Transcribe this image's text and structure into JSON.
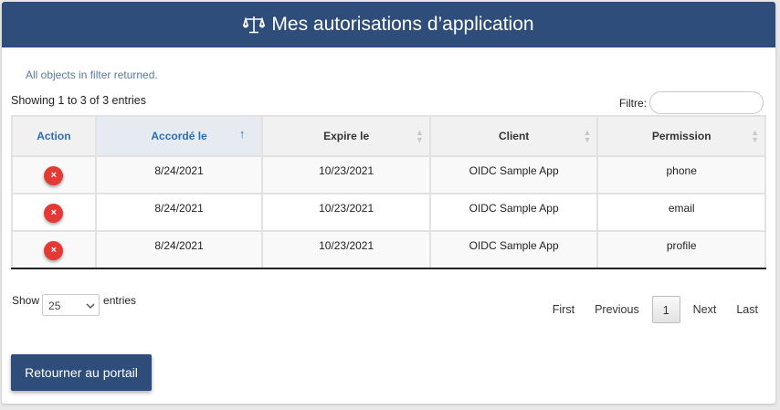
{
  "header": {
    "title": "Mes autorisations d’application",
    "icon": "scale-icon",
    "color": "#2e4d7b"
  },
  "info_message": "All objects in filter returned.",
  "entries_info": "Showing 1 to 3 of 3 entries",
  "filter": {
    "label": "Filtre:",
    "value": ""
  },
  "table": {
    "columns": [
      "Action",
      "Accordé le",
      "Expire le",
      "Client",
      "Permission"
    ],
    "sorted_column": "Accordé le",
    "sort_direction": "ascending",
    "rows": [
      {
        "action_icon": "delete-icon",
        "action_symbol": "×",
        "granted": "8/24/2021",
        "expires": "10/23/2021",
        "client": "OIDC Sample App",
        "permission": "phone"
      },
      {
        "action_icon": "delete-icon",
        "action_symbol": "×",
        "granted": "8/24/2021",
        "expires": "10/23/2021",
        "client": "OIDC Sample App",
        "permission": "email"
      },
      {
        "action_icon": "delete-icon",
        "action_symbol": "×",
        "granted": "8/24/2021",
        "expires": "10/23/2021",
        "client": "OIDC Sample App",
        "permission": "profile"
      }
    ]
  },
  "length_control": {
    "prefix": "Show",
    "selected": "25",
    "suffix": "entries"
  },
  "pagination": {
    "first": "First",
    "previous": "Previous",
    "current": "1",
    "next": "Next",
    "last": "Last"
  },
  "back_button": "Retourner au portail",
  "colors": {
    "accent": "#2b6cb8",
    "delete": "#e53935",
    "header_bg": "#2e4d7b"
  }
}
